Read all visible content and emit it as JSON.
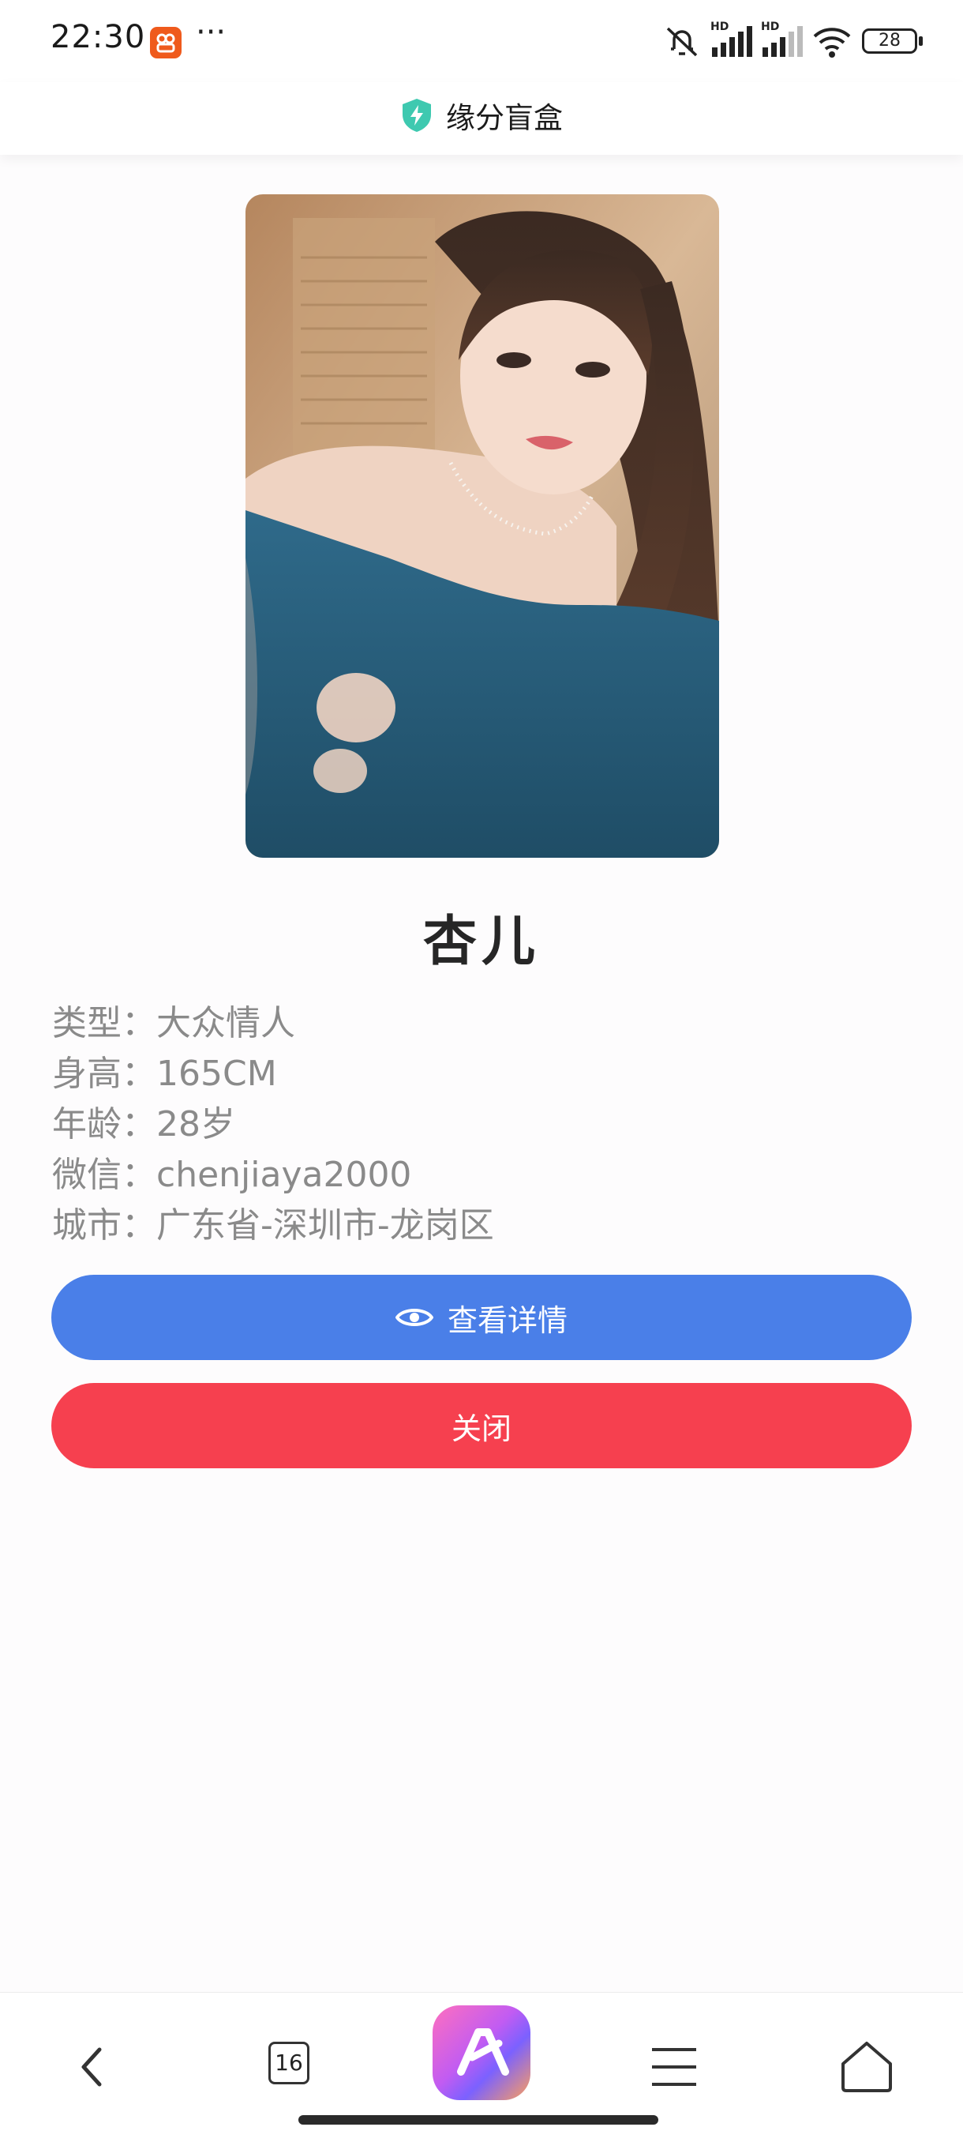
{
  "status_bar": {
    "time": "22:30",
    "more": "···",
    "battery": "28",
    "hd1": "HD",
    "hd2": "HD"
  },
  "header": {
    "title": "缘分盲盒",
    "icon": "shield-bolt-icon",
    "accent": "#3ec9b0"
  },
  "profile": {
    "name": "杏儿",
    "photo_desc": "portrait-photo",
    "fields": [
      {
        "label": "类型：",
        "value": "大众情人"
      },
      {
        "label": "身高：",
        "value": "165CM"
      },
      {
        "label": "年龄：",
        "value": "28岁"
      },
      {
        "label": "微信：",
        "value": "chenjiaya2000"
      },
      {
        "label": "城市：",
        "value": "广东省-深圳市-龙岗区"
      }
    ]
  },
  "buttons": {
    "view_details": "查看详情",
    "view_icon": "eye-icon",
    "view_color": "#4a7fe8",
    "close": "关闭",
    "close_color": "#f6404f"
  },
  "bottom_nav": {
    "tab_count": "16",
    "items": [
      "back-icon",
      "tabs-icon",
      "app-launcher-icon",
      "menu-icon",
      "home-icon"
    ]
  }
}
